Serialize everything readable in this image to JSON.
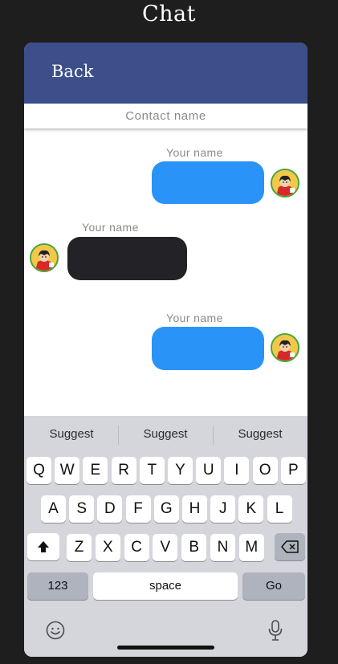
{
  "page": {
    "title": "Chat"
  },
  "header": {
    "back_label": "Back"
  },
  "contact": {
    "name": "Contact name"
  },
  "messages": [
    {
      "sender": "Your name",
      "side": "right"
    },
    {
      "sender": "Your name",
      "side": "left"
    },
    {
      "sender": "Your name",
      "side": "right"
    }
  ],
  "keyboard": {
    "suggestions": [
      "Suggest",
      "Suggest",
      "Suggest"
    ],
    "row1": [
      "Q",
      "W",
      "E",
      "R",
      "T",
      "Y",
      "U",
      "I",
      "O",
      "P"
    ],
    "row2": [
      "A",
      "S",
      "D",
      "F",
      "G",
      "H",
      "J",
      "K",
      "L"
    ],
    "row3": [
      "Z",
      "X",
      "C",
      "V",
      "B",
      "N",
      "M"
    ],
    "numbers_label": "123",
    "space_label": "space",
    "go_label": "Go",
    "shift_icon": "shift-icon",
    "backspace_icon": "backspace-icon",
    "emoji_icon": "emoji-icon",
    "mic_icon": "microphone-icon"
  },
  "colors": {
    "header": "#3c4f8a",
    "sent_bubble": "#2a93f7",
    "received_bubble": "#232327",
    "avatar_ring": "#4aa43a"
  }
}
